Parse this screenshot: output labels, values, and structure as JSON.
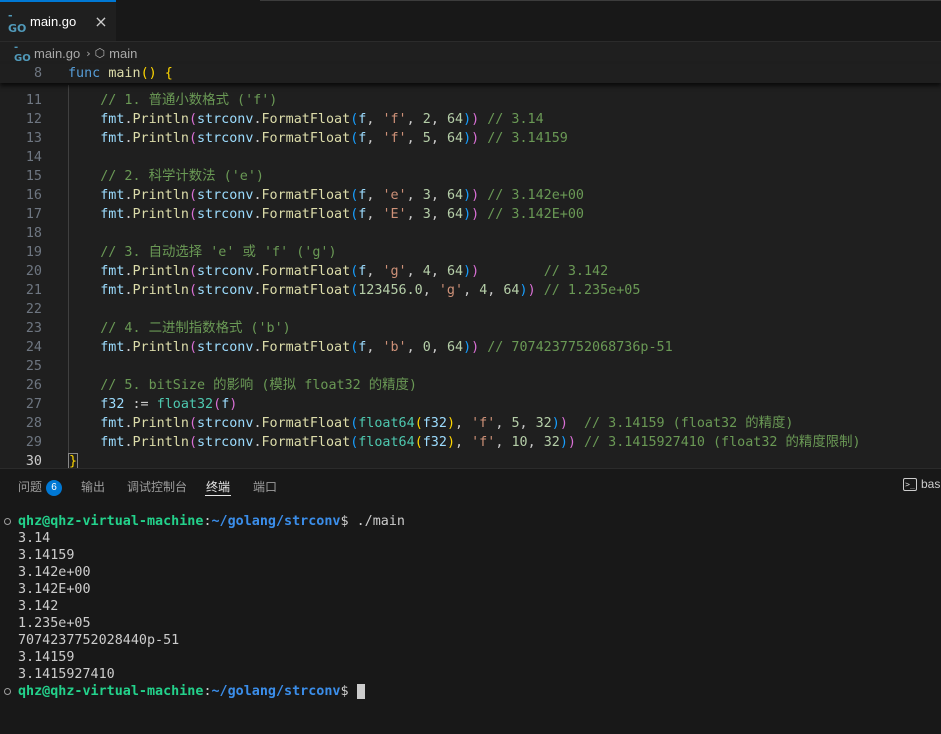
{
  "tab": {
    "icon": "go-file-icon",
    "label": "main.go",
    "close": "×"
  },
  "breadcrumb": {
    "file": "main.go",
    "symbol": "main"
  },
  "panel": {
    "tabs": [
      {
        "label": "问题",
        "badge": "6"
      },
      {
        "label": "输出"
      },
      {
        "label": "调试控制台"
      },
      {
        "label": "终端",
        "active": true
      },
      {
        "label": "端口"
      }
    ],
    "terminal_switch_label": "bas"
  },
  "terminal": {
    "prompt_user": "qhz@qhz-virtual-machine",
    "prompt_path": "~/golang/strconv",
    "command": "./main",
    "output": [
      "3.14",
      "3.14159",
      "3.142e+00",
      "3.142E+00",
      "3.142",
      "1.235e+05",
      "7074237752028440p-51",
      "3.14159",
      "3.1415927410"
    ]
  },
  "colors": {
    "accent": "#0078d4",
    "terminal_user": "#23d18b",
    "terminal_path": "#3b8eea"
  }
}
